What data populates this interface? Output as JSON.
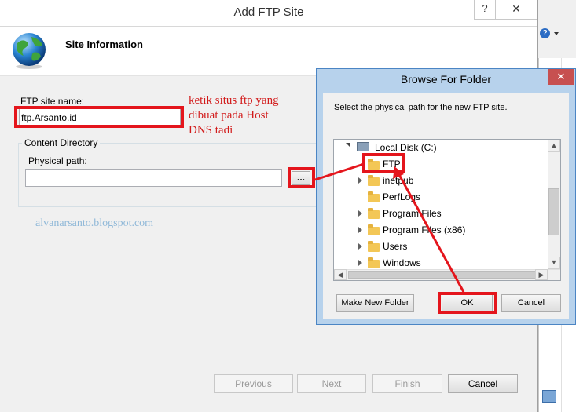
{
  "wizard": {
    "title": "Add FTP Site",
    "header": "Site Information",
    "site_name_label": "FTP site name:",
    "site_name_value": "ftp.Arsanto.id",
    "content_directory_label": "Content Directory",
    "physical_path_label": "Physical path:",
    "physical_path_value": "",
    "browse_label": "...",
    "buttons": {
      "previous": "Previous",
      "next": "Next",
      "finish": "Finish",
      "cancel": "Cancel"
    },
    "window_controls": {
      "help": "?",
      "close": "✕"
    }
  },
  "annotations": {
    "note_line1": "ketik situs ftp yang",
    "note_line2": "dibuat pada Host",
    "note_line3": "DNS tadi",
    "watermark": "alvanarsanto.blogspot.com"
  },
  "browse_dialog": {
    "title": "Browse For Folder",
    "instruction": "Select the physical path for the new FTP site.",
    "close": "✕",
    "tree": {
      "root": "Local Disk (C:)",
      "items": [
        "FTP",
        "inetpub",
        "PerfLogs",
        "Program Files",
        "Program Files (x86)",
        "Users",
        "Windows"
      ],
      "selected": "FTP"
    },
    "buttons": {
      "new_folder": "Make New Folder",
      "ok": "OK",
      "cancel": "Cancel"
    }
  },
  "colors": {
    "annotation_red": "#e4151c",
    "dialog_border": "#4b85c4",
    "dialog_frame": "#b7d2ec"
  }
}
